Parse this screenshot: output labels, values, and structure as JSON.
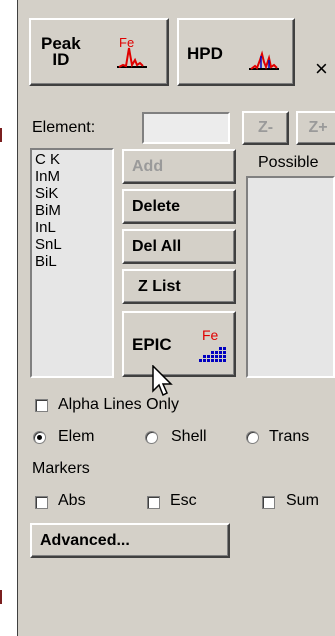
{
  "toolbar": {
    "peak_id_label_line1": "Peak",
    "peak_id_label_line2": "ID",
    "peak_id_icon_text": "Fe",
    "hpd_label": "HPD",
    "close_glyph": "×"
  },
  "element": {
    "label": "Element:",
    "input_value": "",
    "z_minus": "Z-",
    "z_plus": "Z+"
  },
  "possible": {
    "label": "Possible"
  },
  "element_list": [
    "C K",
    "InM",
    "SiK",
    "BiM",
    "InL",
    "SnL",
    "BiL"
  ],
  "actions": {
    "add": "Add",
    "delete": "Delete",
    "del_all": "Del All",
    "z_list": "Z List",
    "epic": "EPIC",
    "epic_icon_text": "Fe"
  },
  "options": {
    "alpha_lines_only": "Alpha Lines Only",
    "elem": "Elem",
    "shell": "Shell",
    "trans": "Trans",
    "selected_mode": "Elem"
  },
  "markers": {
    "label": "Markers",
    "abs": "Abs",
    "esc": "Esc",
    "sum": "Sum"
  },
  "advanced": {
    "label": "Advanced..."
  },
  "colors": {
    "panel_bg": "#d4d0c8",
    "spectrum_red": "#e00000",
    "spectrum_blue": "#0000c0"
  }
}
